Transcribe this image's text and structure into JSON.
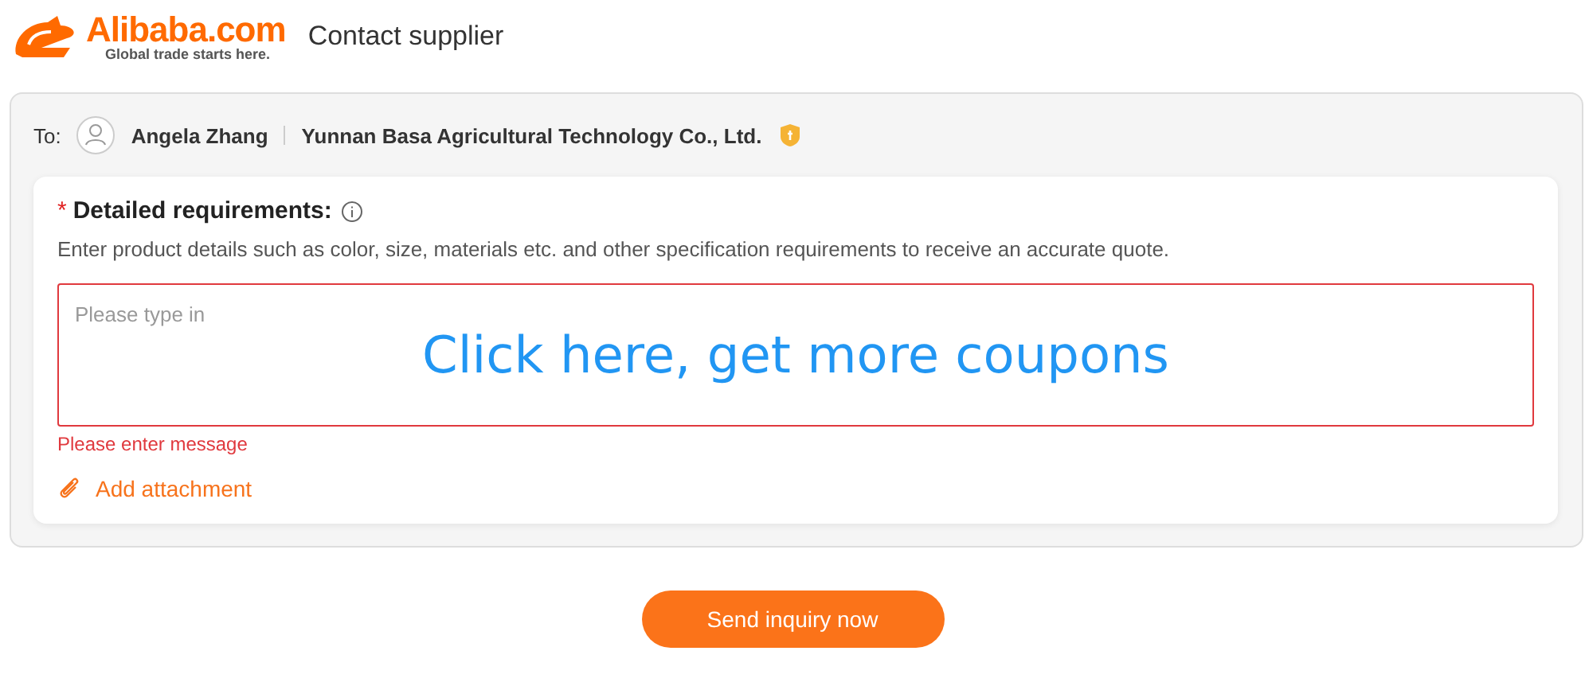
{
  "logo": {
    "name": "Alibaba.com",
    "tagline": "Global trade starts here."
  },
  "page_title": "Contact supplier",
  "recipient": {
    "label": "To:",
    "name": "Angela Zhang",
    "company": "Yunnan Basa Agricultural Technology Co., Ltd."
  },
  "requirements": {
    "label": "Detailed requirements:",
    "required_mark": "*",
    "hint": "Enter product details such as color, size, materials etc. and other specification requirements to receive an accurate quote.",
    "placeholder": "Please type in",
    "coupon_link": "Click here, get more coupons",
    "error": "Please enter message",
    "attachment": "Add attachment"
  },
  "submit": "Send inquiry now"
}
